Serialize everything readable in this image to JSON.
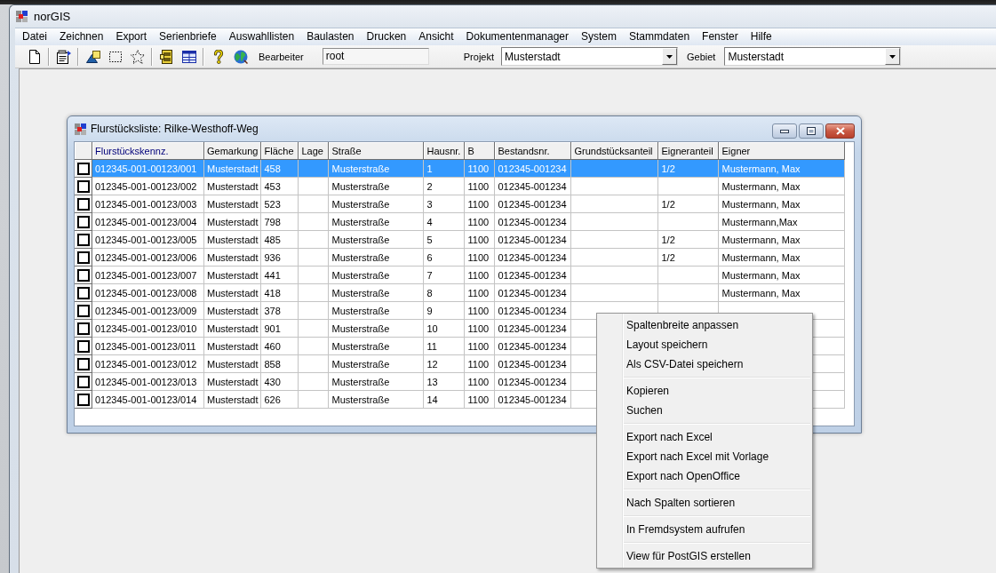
{
  "window": {
    "title": "norGIS"
  },
  "menu_bar": [
    "Datei",
    "Zeichnen",
    "Export",
    "Serienbriefe",
    "Auswahllisten",
    "Baulasten",
    "Drucken",
    "Ansicht",
    "Dokumentenmanager",
    "System",
    "Stammdaten",
    "Fenster",
    "Hilfe"
  ],
  "toolbar": {
    "fields": [
      {
        "kind": "text",
        "label": "Bearbeiter",
        "value": "root"
      },
      {
        "kind": "select",
        "label": "Projekt",
        "value": "Musterstadt"
      },
      {
        "kind": "select",
        "label": "Gebiet",
        "value": "Musterstadt"
      }
    ]
  },
  "child_window": {
    "title": "Flurstücksliste: Rilke-Westhoff-Weg",
    "table": {
      "columns": [
        {
          "label": "Flurstückskennz.",
          "selected": true
        },
        {
          "label": "Gemarkung",
          "selected": false
        },
        {
          "label": "Fläche",
          "selected": false
        },
        {
          "label": "Lage",
          "selected": false
        },
        {
          "label": "Straße",
          "selected": false
        },
        {
          "label": "Hausnr.",
          "selected": false
        },
        {
          "label": "B",
          "selected": false
        },
        {
          "label": "Bestandsnr.",
          "selected": false
        },
        {
          "label": "Grundstücksanteil",
          "selected": false
        },
        {
          "label": "Eigneranteil",
          "selected": false
        },
        {
          "label": "Eigner",
          "selected": false
        }
      ],
      "rows": [
        {
          "selected": true,
          "checked": false,
          "flurstueckskennz": "012345-001-00123/001",
          "gemarkung": "Musterstadt",
          "flaeche": "458",
          "strasse": "Musterstraße",
          "hausnr": "1",
          "b": "1100",
          "bestandsnr": "012345-001234",
          "eigneranteil": "1/2",
          "eigner": "Mustermann, Max"
        },
        {
          "selected": false,
          "checked": false,
          "flurstueckskennz": "012345-001-00123/002",
          "gemarkung": "Musterstadt",
          "flaeche": "453",
          "strasse": "Musterstraße",
          "hausnr": "2",
          "b": "1100",
          "bestandsnr": "012345-001234",
          "eigner": "Mustermann, Max"
        },
        {
          "selected": false,
          "checked": false,
          "flurstueckskennz": "012345-001-00123/003",
          "gemarkung": "Musterstadt",
          "flaeche": "523",
          "strasse": "Musterstraße",
          "hausnr": "3",
          "b": "1100",
          "bestandsnr": "012345-001234",
          "eigneranteil": "1/2",
          "eigner": "Mustermann, Max"
        },
        {
          "selected": false,
          "checked": false,
          "flurstueckskennz": "012345-001-00123/004",
          "gemarkung": "Musterstadt",
          "flaeche": "798",
          "strasse": "Musterstraße",
          "hausnr": "4",
          "b": "1100",
          "bestandsnr": "012345-001234",
          "eigner": "Mustermann,Max"
        },
        {
          "selected": false,
          "checked": false,
          "flurstueckskennz": "012345-001-00123/005",
          "gemarkung": "Musterstadt",
          "flaeche": "485",
          "strasse": "Musterstraße",
          "hausnr": "5",
          "b": "1100",
          "bestandsnr": "012345-001234",
          "eigneranteil": "1/2",
          "eigner": "Mustermann, Max"
        },
        {
          "selected": false,
          "checked": false,
          "flurstueckskennz": "012345-001-00123/006",
          "gemarkung": "Musterstadt",
          "flaeche": "936",
          "strasse": "Musterstraße",
          "hausnr": "6",
          "b": "1100",
          "bestandsnr": "012345-001234",
          "eigneranteil": "1/2",
          "eigner": "Mustermann, Max"
        },
        {
          "selected": false,
          "checked": false,
          "flurstueckskennz": "012345-001-00123/007",
          "gemarkung": "Musterstadt",
          "flaeche": "441",
          "strasse": "Musterstraße",
          "hausnr": "7",
          "b": "1100",
          "bestandsnr": "012345-001234",
          "eigner": "Mustermann, Max"
        },
        {
          "selected": false,
          "checked": false,
          "flurstueckskennz": "012345-001-00123/008",
          "gemarkung": "Musterstadt",
          "flaeche": "418",
          "strasse": "Musterstraße",
          "hausnr": "8",
          "b": "1100",
          "bestandsnr": "012345-001234",
          "eigner": "Mustermann, Max"
        },
        {
          "selected": false,
          "checked": false,
          "flurstueckskennz": "012345-001-00123/009",
          "gemarkung": "Musterstadt",
          "flaeche": "378",
          "strasse": "Musterstraße",
          "hausnr": "9",
          "b": "1100",
          "bestandsnr": "012345-001234"
        },
        {
          "selected": false,
          "checked": false,
          "flurstueckskennz": "012345-001-00123/010",
          "gemarkung": "Musterstadt",
          "flaeche": "901",
          "strasse": "Musterstraße",
          "hausnr": "10",
          "b": "1100",
          "bestandsnr": "012345-001234"
        },
        {
          "selected": false,
          "checked": false,
          "flurstueckskennz": "012345-001-00123/011",
          "gemarkung": "Musterstadt",
          "flaeche": "460",
          "strasse": "Musterstraße",
          "hausnr": "11",
          "b": "1100",
          "bestandsnr": "012345-001234"
        },
        {
          "selected": false,
          "checked": false,
          "flurstueckskennz": "012345-001-00123/012",
          "gemarkung": "Musterstadt",
          "flaeche": "858",
          "strasse": "Musterstraße",
          "hausnr": "12",
          "b": "1100",
          "bestandsnr": "012345-001234"
        },
        {
          "selected": false,
          "checked": false,
          "flurstueckskennz": "012345-001-00123/013",
          "gemarkung": "Musterstadt",
          "flaeche": "430",
          "strasse": "Musterstraße",
          "hausnr": "13",
          "b": "1100",
          "bestandsnr": "012345-001234"
        },
        {
          "selected": false,
          "checked": false,
          "flurstueckskennz": "012345-001-00123/014",
          "gemarkung": "Musterstadt",
          "flaeche": "626",
          "strasse": "Musterstraße",
          "hausnr": "14",
          "b": "1100",
          "bestandsnr": "012345-001234"
        }
      ]
    }
  },
  "context_menu": {
    "groups": [
      [
        "Spaltenbreite anpassen",
        "Layout speichern",
        "Als CSV-Datei speichern"
      ],
      [
        "Kopieren",
        "Suchen"
      ],
      [
        "Export nach Excel",
        "Export nach Excel mit Vorlage",
        "Export nach OpenOffice"
      ],
      [
        "Nach Spalten sortieren"
      ],
      [
        "In Fremdsystem aufrufen"
      ],
      [
        "View für PostGIS erstellen"
      ]
    ]
  }
}
